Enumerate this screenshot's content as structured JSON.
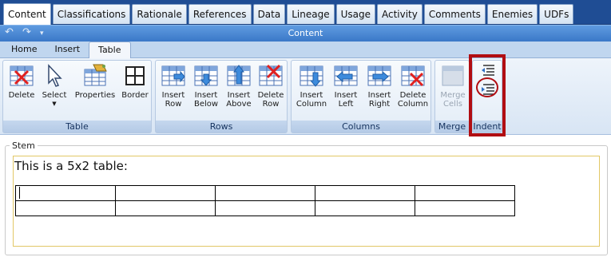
{
  "top_tabs": [
    "Content",
    "Classifications",
    "Rationale",
    "References",
    "Data",
    "Lineage",
    "Usage",
    "Activity",
    "Comments",
    "Enemies",
    "UDFs"
  ],
  "title": "Content",
  "quick_access": {
    "undo_icon": "undo-icon",
    "redo_icon": "redo-icon",
    "menu_icon": "dropdown-icon"
  },
  "ribbon_tabs": [
    "Home",
    "Insert",
    "Table"
  ],
  "active_ribbon_tab": "Table",
  "groups": {
    "table": {
      "label": "Table",
      "buttons": {
        "delete": "Delete",
        "select": "Select",
        "properties": "Properties",
        "border": "Border"
      }
    },
    "rows": {
      "label": "Rows",
      "buttons": {
        "insert_row": "Insert Row",
        "insert_below": "Insert Below",
        "insert_above": "Insert Above",
        "delete_row": "Delete Row"
      }
    },
    "columns": {
      "label": "Columns",
      "buttons": {
        "insert_column": "Insert Column",
        "insert_left": "Insert Left",
        "insert_right": "Insert Right",
        "delete_column": "Delete Column"
      }
    },
    "merge": {
      "label": "Merge",
      "buttons": {
        "merge_cells": "Merge Cells"
      }
    },
    "indent": {
      "label": "Indent"
    }
  },
  "stem": {
    "label": "Stem",
    "text": "This is a 5x2 table:",
    "table": {
      "rows": 2,
      "cols": 5
    }
  },
  "colors": {
    "highlight": "#b10d12",
    "tab_strip": "#1f4d94",
    "title_bar": "#4a89d6"
  }
}
